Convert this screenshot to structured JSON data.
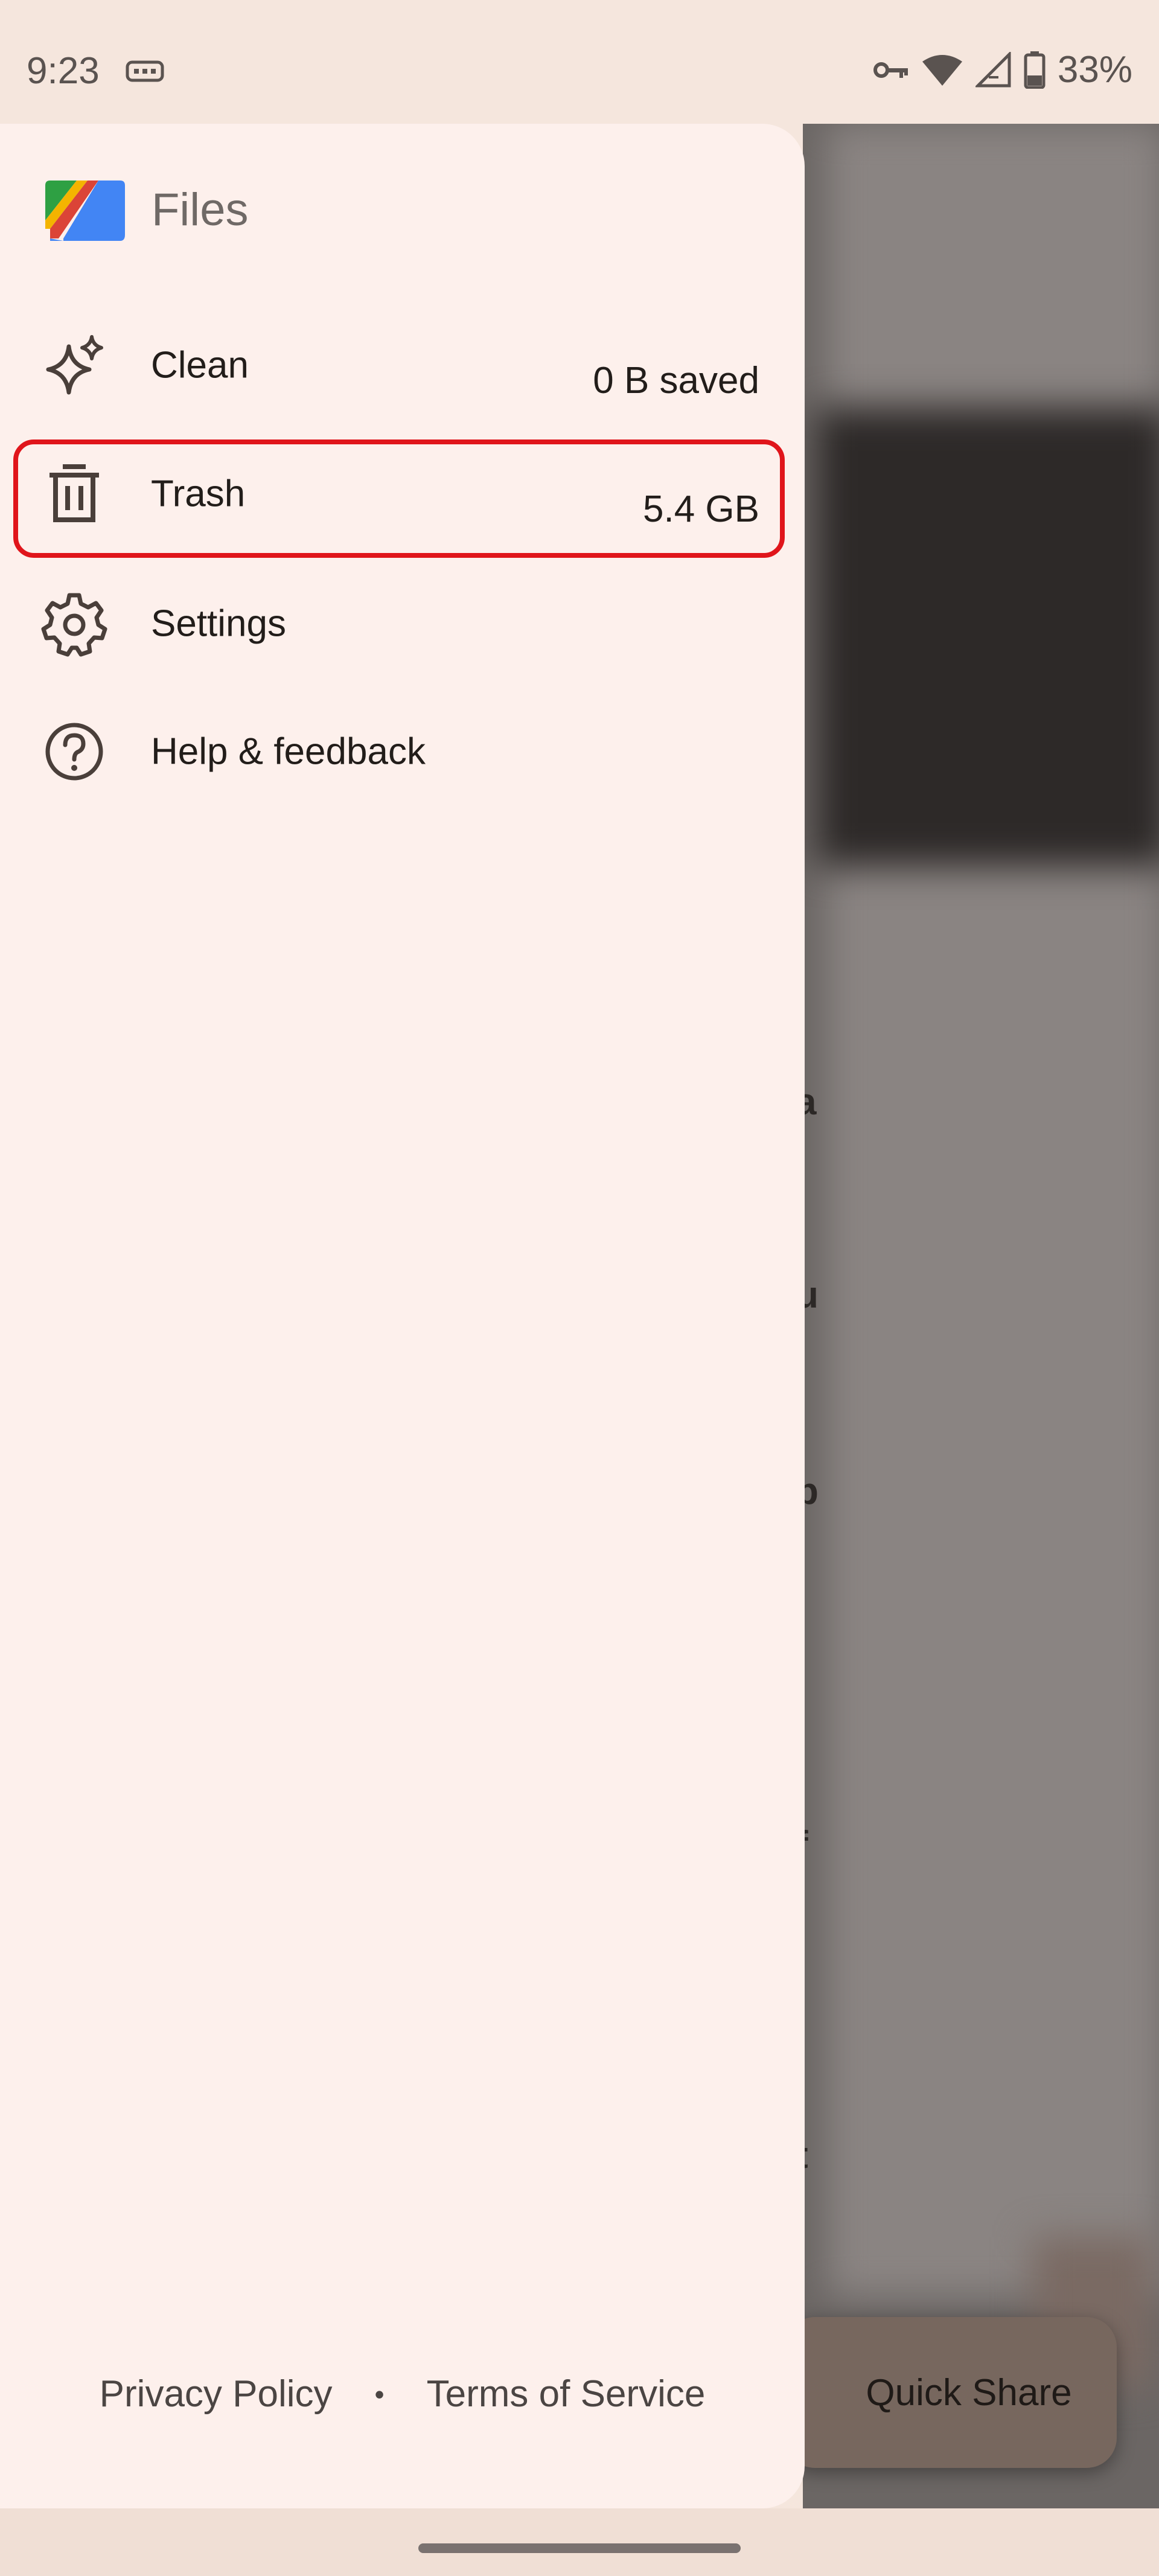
{
  "status_bar": {
    "time": "9:23",
    "battery": "33%",
    "icons": [
      "keyboard-icon",
      "vpn-key-icon",
      "wifi-icon",
      "signal-icon",
      "battery-icon"
    ]
  },
  "drawer": {
    "app_title": "Files",
    "items": [
      {
        "label": "Clean",
        "meta": "0 B saved",
        "icon": "sparkle-icon"
      },
      {
        "label": "Trash",
        "meta": "5.4 GB",
        "icon": "trash-icon"
      },
      {
        "label": "Settings",
        "meta": "",
        "icon": "gear-icon"
      },
      {
        "label": "Help & feedback",
        "meta": "",
        "icon": "help-icon"
      }
    ],
    "footer": {
      "privacy": "Privacy Policy",
      "separator": "•",
      "terms": "Terms of Service"
    }
  },
  "background": {
    "quick_share_label": "Quick Share"
  },
  "colors": {
    "drawer_bg": "#fdf0ec",
    "highlight": "#e0151b",
    "scrim": "#6b6664"
  }
}
